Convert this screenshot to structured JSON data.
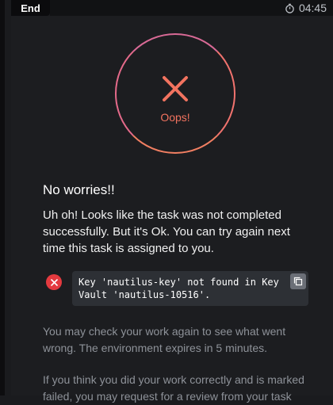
{
  "tab": {
    "label": "End"
  },
  "timer": {
    "value": "04:45",
    "icon": "stopwatch-icon"
  },
  "status": {
    "label": "Oops!",
    "icon": "x-icon",
    "color": "#f2735f"
  },
  "result": {
    "title": "No worries!!",
    "message": "Uh oh! Looks like the task was not completed successfully. But it's Ok. You can try again next time this task is assigned to you."
  },
  "error": {
    "text": "Key 'nautilus-key' not found in Key Vault 'nautilus-10516'.",
    "badge_color": "#e43a3f"
  },
  "hints": {
    "check_work": "You may check your work again to see what went wrong. The environment expires in 5 minutes.",
    "review": "If you think you did your work correctly and is marked failed, you may request for a review from your task"
  }
}
